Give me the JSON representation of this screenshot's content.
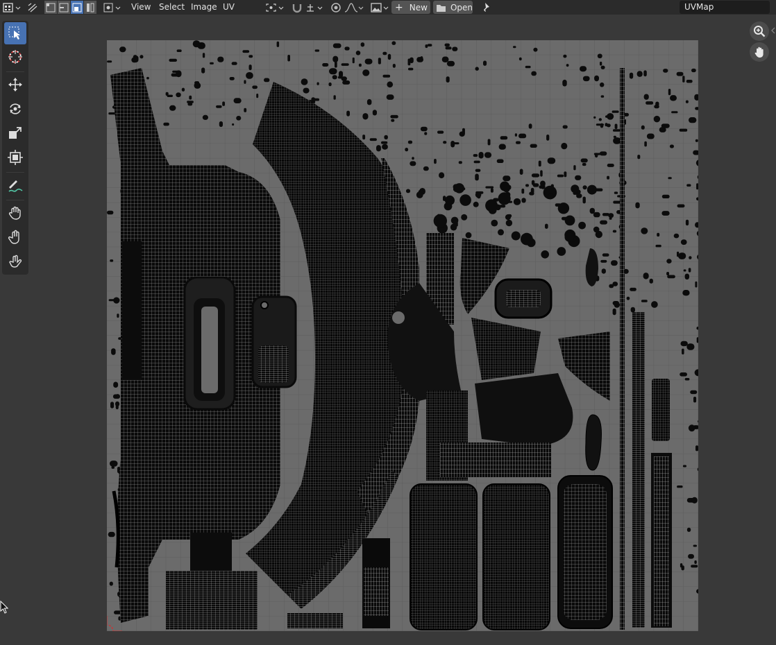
{
  "header": {
    "menus": [
      {
        "name": "menu-view",
        "label": "View"
      },
      {
        "name": "menu-select",
        "label": "Select"
      },
      {
        "name": "menu-image",
        "label": "Image"
      },
      {
        "name": "menu-uv",
        "label": "UV"
      }
    ],
    "new_label": "New",
    "open_label": "Open",
    "uv_map_name": "UVMap"
  },
  "toolbar": {
    "tools": [
      {
        "name": "select-box-tool",
        "icon": "select-box-icon",
        "active": true
      },
      {
        "name": "cursor-tool",
        "icon": "cursor-icon",
        "active": false
      },
      {
        "name": "move-tool",
        "icon": "move-icon",
        "active": false
      },
      {
        "name": "rotate-tool",
        "icon": "rotate-icon",
        "active": false
      },
      {
        "name": "scale-tool",
        "icon": "scale-icon",
        "active": false
      },
      {
        "name": "transform-tool",
        "icon": "transform-icon",
        "active": false
      },
      {
        "name": "annotate-tool",
        "icon": "annotate-icon",
        "active": false
      },
      {
        "name": "grab-tool",
        "icon": "grab-icon",
        "active": false
      },
      {
        "name": "relax-tool",
        "icon": "relax-icon",
        "active": false
      },
      {
        "name": "pinch-tool",
        "icon": "pinch-icon",
        "active": false
      }
    ]
  },
  "navigation": {
    "zoom_icon": "zoom-icon",
    "pan_icon": "hand-icon"
  },
  "colors": {
    "background": "#393939",
    "header": "#2b2b2b",
    "accent": "#4772b3",
    "uv_grid_fill": "#6b6b6b",
    "uv_wire": "#050505"
  }
}
